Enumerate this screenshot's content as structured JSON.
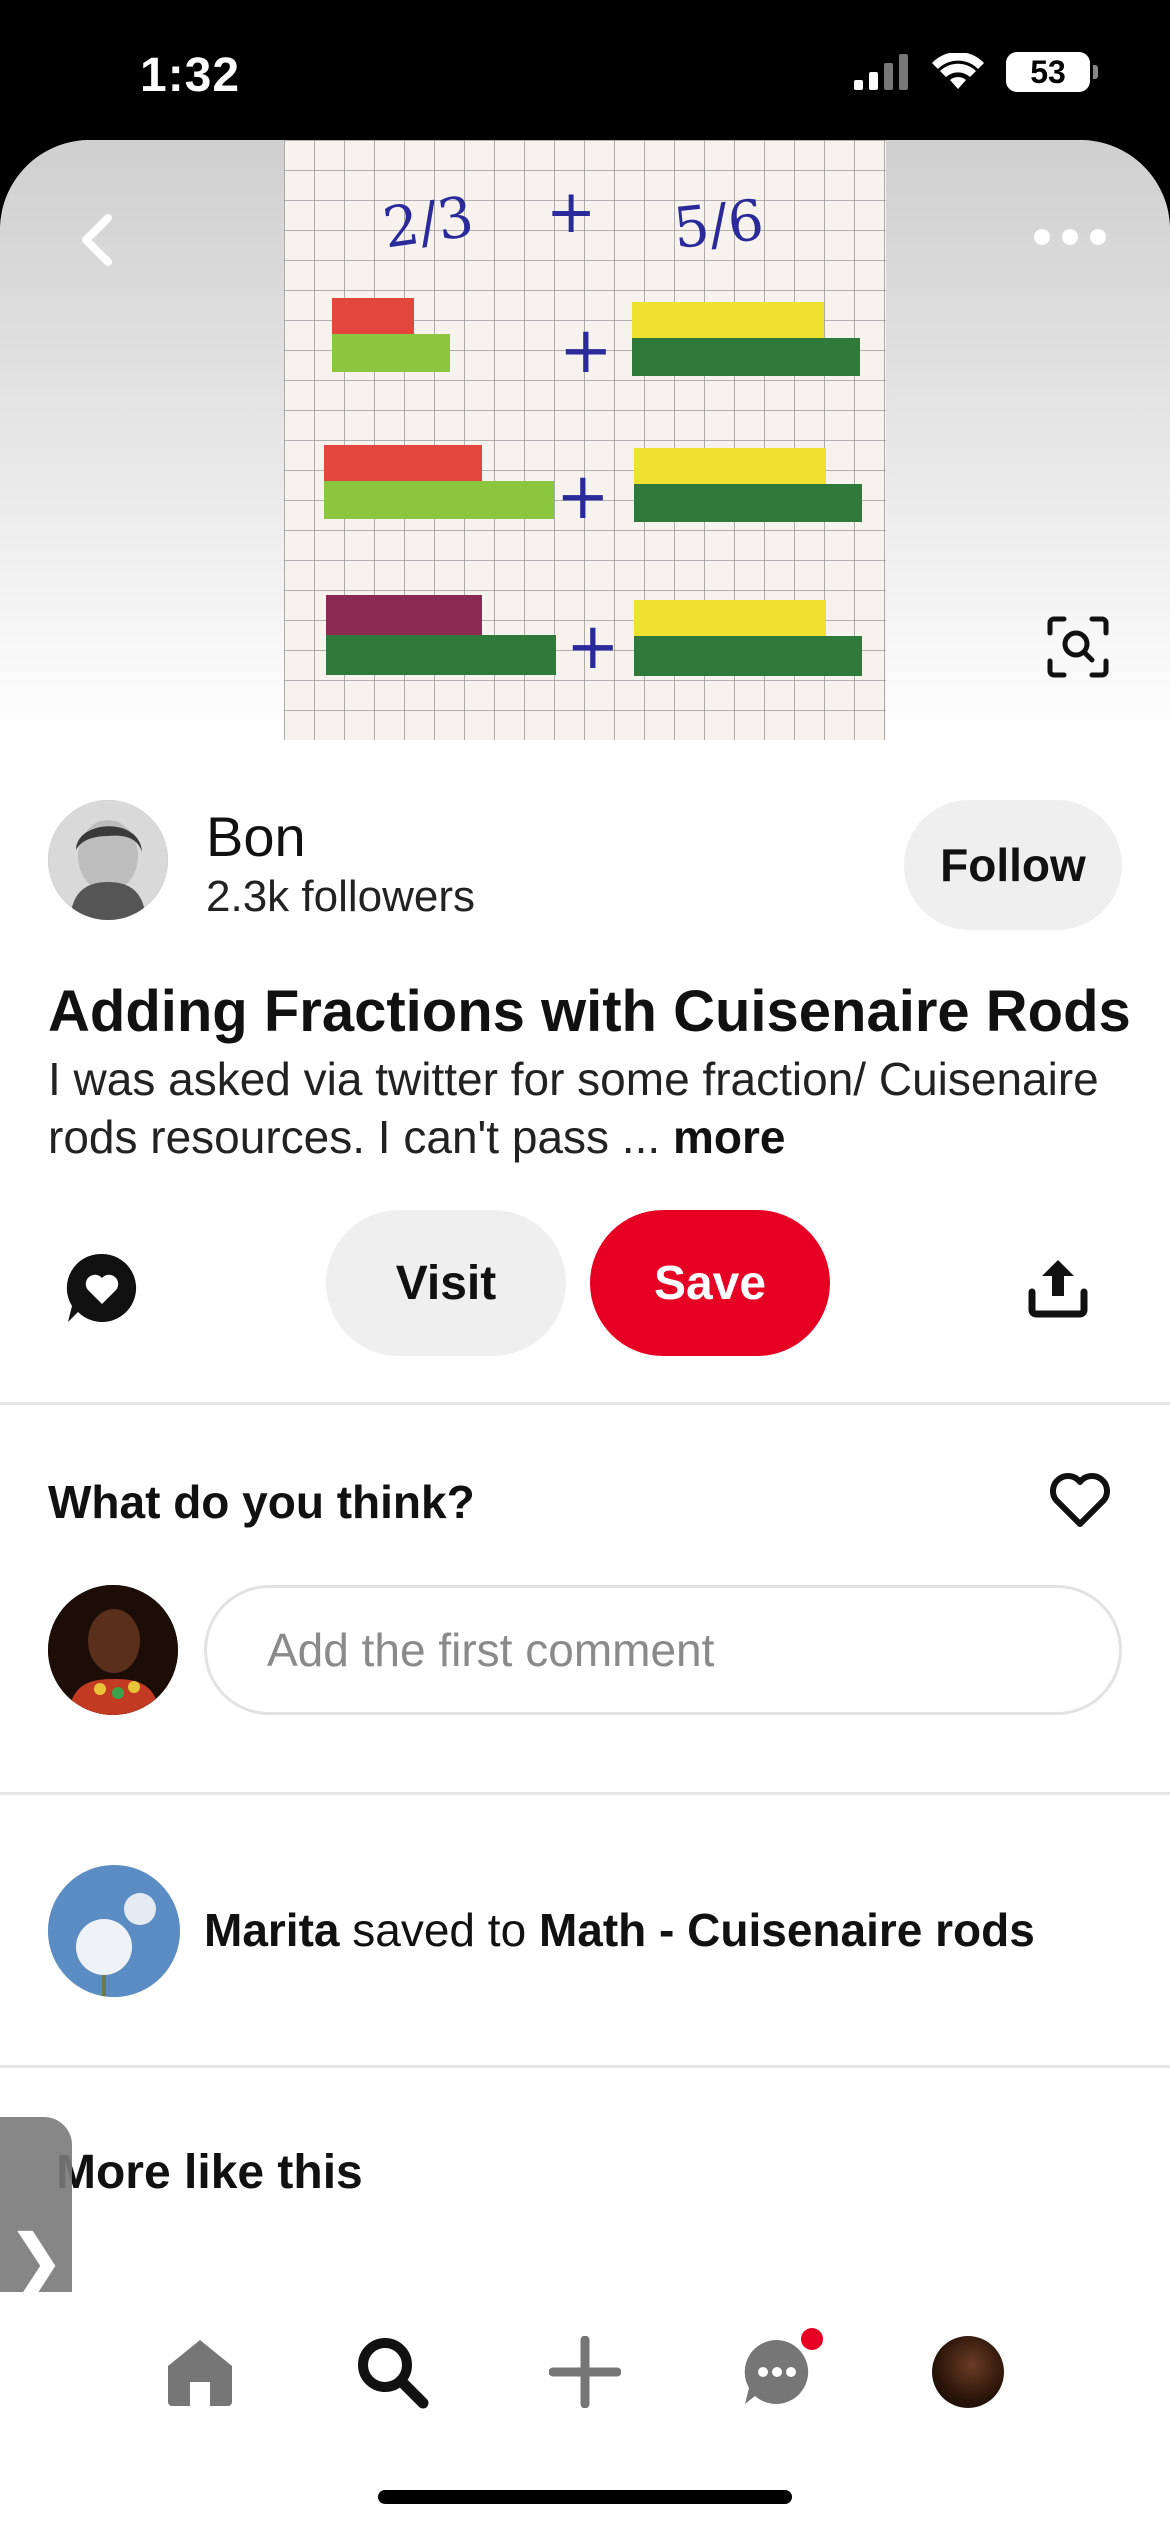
{
  "status_bar": {
    "time": "1:32",
    "battery": "53"
  },
  "pin": {
    "image_fractions": {
      "left": "2/3",
      "plus": "+",
      "right": "5/6"
    },
    "title": "Adding Fractions with Cuisenaire Rods",
    "description": "I was asked via twitter for some fraction/ Cuisenaire rods resources. I can't pass ...",
    "more_label": "more"
  },
  "creator": {
    "name": "Bon",
    "followers": "2.3k followers",
    "follow_label": "Follow"
  },
  "actions": {
    "visit_label": "Visit",
    "save_label": "Save"
  },
  "comments": {
    "title": "What do you think?",
    "placeholder": "Add the first comment"
  },
  "activity": {
    "user": "Marita",
    "verb": "saved to",
    "board": "Math - Cuisenaire rods"
  },
  "more_like_this": {
    "title": "More like this"
  },
  "side_tab": {
    "label": "❯"
  },
  "colors": {
    "save": "#e60023",
    "rod_red": "#e2463c",
    "rod_lightgreen": "#8cc63e",
    "rod_darkgreen": "#2f7a3b",
    "rod_yellow": "#f0e030",
    "rod_purple": "#8a2a52",
    "ink": "#2a2a9a"
  }
}
